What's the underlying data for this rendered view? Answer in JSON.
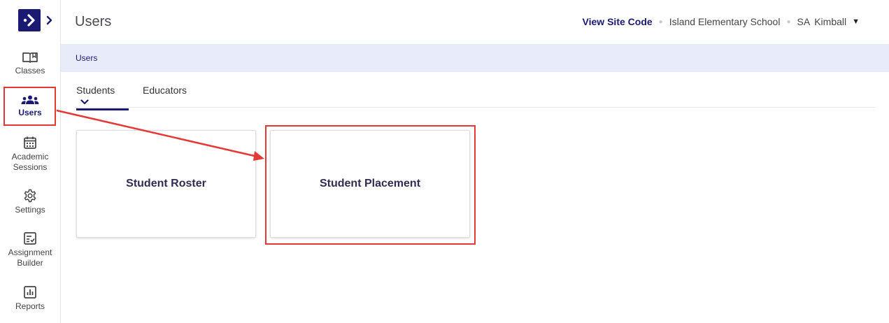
{
  "header": {
    "title": "Users",
    "view_site_code": "View Site Code",
    "school": "Island Elementary School",
    "user_initials": "SA",
    "user_name": "Kimball"
  },
  "sidebar": {
    "items": [
      {
        "label": "Classes",
        "icon": "book-open-icon"
      },
      {
        "label": "Users",
        "icon": "users-icon",
        "active": true
      },
      {
        "label": "Academic Sessions",
        "icon": "calendar-icon"
      },
      {
        "label": "Settings",
        "icon": "gear-icon"
      },
      {
        "label": "Assignment Builder",
        "icon": "checklist-icon"
      },
      {
        "label": "Reports",
        "icon": "bar-chart-icon"
      }
    ]
  },
  "breadcrumb": {
    "current": "Users"
  },
  "tabs": [
    {
      "label": "Students",
      "active": true
    },
    {
      "label": "Educators",
      "active": false
    }
  ],
  "cards": [
    {
      "label": "Student Roster"
    },
    {
      "label": "Student Placement",
      "highlighted": true
    }
  ],
  "colors": {
    "brand": "#1b1a72",
    "highlight": "#e53935",
    "breadcrumb_bg": "#e8ebfa"
  }
}
